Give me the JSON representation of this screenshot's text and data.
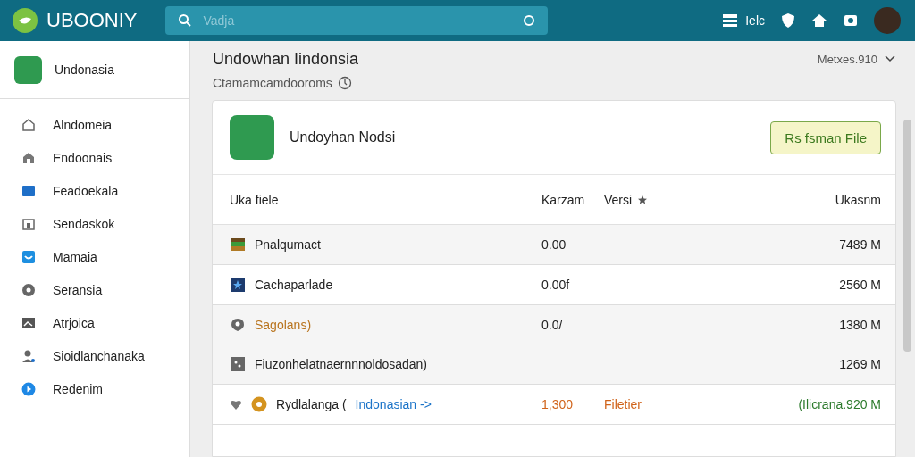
{
  "header": {
    "logo": "UBOONIY",
    "search": {
      "placeholder": "Vadja"
    },
    "label": "Ielc"
  },
  "sidebar": {
    "profile": {
      "name": "Undonasia"
    },
    "items": [
      {
        "label": "Alndomeia",
        "selected": false
      },
      {
        "label": "Endoonais",
        "selected": false
      },
      {
        "label": "Feadoekala",
        "selected": false
      },
      {
        "label": "Sendaskok",
        "selected": false
      },
      {
        "label": "Mamaia",
        "selected": false
      },
      {
        "label": "Seransia",
        "selected": false
      },
      {
        "label": "Atrjoica",
        "selected": false
      },
      {
        "label": "Sioidlanchanaka",
        "selected": false
      },
      {
        "label": "Redenim",
        "selected": false
      }
    ]
  },
  "page": {
    "title": "Undowhan Iindonsia",
    "subtitle": "Ctamamcamdooroms",
    "sort": "Metxes.910"
  },
  "card": {
    "name": "Undoyhan Nodsi",
    "button": "Rs fsman File",
    "columns": [
      "Uka fiele",
      "Karzam",
      "Versi",
      "Ukasnm"
    ],
    "rows": [
      {
        "kind": "normal",
        "name": "Pnalqumact",
        "value": "0.00",
        "size": "7489 M"
      },
      {
        "kind": "normal",
        "name": "Cachaparlade",
        "value": "0.00f",
        "size": "2560 M"
      },
      {
        "kind": "normal",
        "name": "Sagolans)",
        "color": "#b8731c",
        "value": "0.0/",
        "size": "1380 M"
      },
      {
        "kind": "normal",
        "name": "Fiuzonhelatnaernnnoldosadan)",
        "size": "1269 M"
      },
      {
        "kind": "highlight",
        "name": "Rydlalanga (",
        "link": "Indonasian ->",
        "value": "1,300",
        "version": "Filetier",
        "size": "(Ilicrana.920 M"
      }
    ]
  }
}
